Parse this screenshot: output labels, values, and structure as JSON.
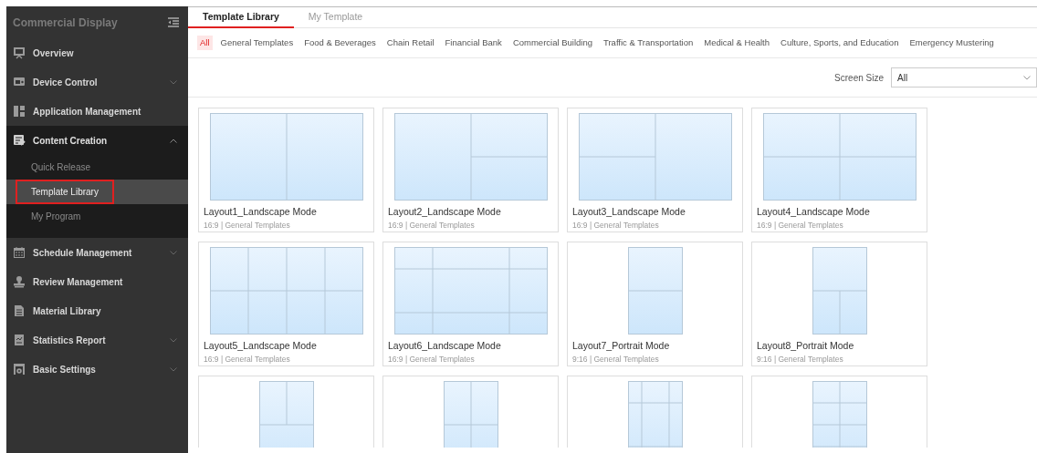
{
  "sidebar": {
    "title": "Commercial Display",
    "items": [
      {
        "label": "Overview"
      },
      {
        "label": "Device Control",
        "expanded": false
      },
      {
        "label": "Application Management"
      },
      {
        "label": "Content Creation",
        "expanded": true,
        "children": [
          {
            "label": "Quick Release",
            "selected": false,
            "highlighted": false
          },
          {
            "label": "Template Library",
            "selected": true,
            "highlighted": true
          },
          {
            "label": "My Program",
            "selected": false,
            "highlighted": false
          }
        ]
      },
      {
        "label": "Schedule Management",
        "expanded": false
      },
      {
        "label": "Review Management"
      },
      {
        "label": "Material Library"
      },
      {
        "label": "Statistics Report",
        "expanded": false
      },
      {
        "label": "Basic Settings",
        "expanded": false
      }
    ]
  },
  "tabs": [
    {
      "label": "Template Library",
      "selected": true
    },
    {
      "label": "My Template",
      "selected": false
    }
  ],
  "categories": [
    {
      "label": "All",
      "selected": true
    },
    {
      "label": "General Templates",
      "selected": false
    },
    {
      "label": "Food & Beverages",
      "selected": false
    },
    {
      "label": "Chain Retail",
      "selected": false
    },
    {
      "label": "Financial Bank",
      "selected": false
    },
    {
      "label": "Commercial Building",
      "selected": false
    },
    {
      "label": "Traffic & Transportation",
      "selected": false
    },
    {
      "label": "Medical & Health",
      "selected": false
    },
    {
      "label": "Culture, Sports, and Education",
      "selected": false
    },
    {
      "label": "Emergency Mustering",
      "selected": false
    }
  ],
  "filter": {
    "label": "Screen Size",
    "value": "All"
  },
  "templates": [
    {
      "title": "Layout1_Landscape Mode",
      "meta": "16:9 | General Templates",
      "kind": "halves"
    },
    {
      "title": "Layout2_Landscape Mode",
      "meta": "16:9 | General Templates",
      "kind": "right-stack"
    },
    {
      "title": "Layout3_Landscape Mode",
      "meta": "16:9 | General Templates",
      "kind": "left-stack"
    },
    {
      "title": "Layout4_Landscape Mode",
      "meta": "16:9 | General Templates",
      "kind": "quad"
    },
    {
      "title": "Layout5_Landscape Mode",
      "meta": "16:9 | General Templates",
      "kind": "eight"
    },
    {
      "title": "Layout6_Landscape Mode",
      "meta": "16:9 | General Templates",
      "kind": "frame"
    },
    {
      "title": "Layout7_Portrait Mode",
      "meta": "9:16 | General Templates",
      "kind": "tall-rows"
    },
    {
      "title": "Layout8_Portrait Mode",
      "meta": "9:16 | General Templates",
      "kind": "tall-bottom-pair"
    },
    {
      "kind": "tall-top-pair"
    },
    {
      "kind": "tall-quad"
    },
    {
      "kind": "tall-frame"
    },
    {
      "kind": "tall-eight"
    }
  ]
}
